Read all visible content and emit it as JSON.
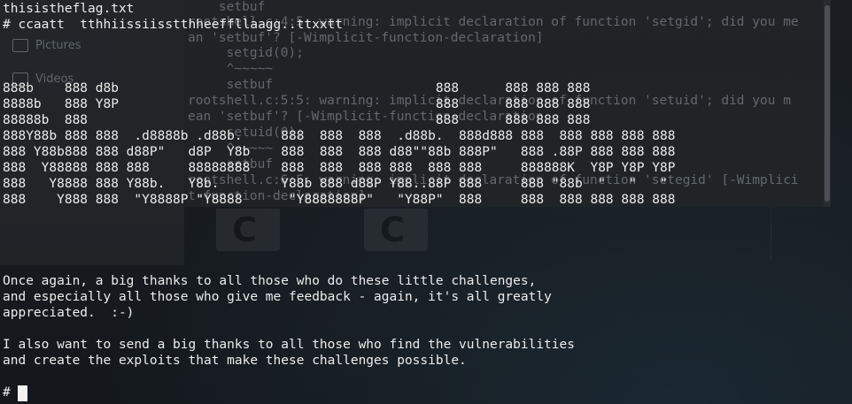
{
  "background": {
    "sidebar_items": [
      {
        "label": "Pictures",
        "icon": "folder-icon"
      },
      {
        "label": "Videos",
        "icon": "folder-icon"
      }
    ],
    "compiler_output": [
      {
        "plain": "    setbuf",
        "bold": ""
      },
      {
        "plain": "rootshell.c:4:5: warning: implicit declaration of function 'setgid'; did you me",
        "bold": ""
      },
      {
        "plain": "an 'setbuf'? [-Wimplicit-function-declaration]",
        "bold": ""
      },
      {
        "plain": "     setgid(0);",
        "bold": ""
      },
      {
        "plain": "     ^~~~~~",
        "bold": ""
      },
      {
        "plain": "     setbuf",
        "bold": ""
      },
      {
        "plain": "rootshell.c:5:5: warning: implicit declaration of function 'setuid'; did you m",
        "bold": ""
      },
      {
        "plain": "ean 'setbuf'? [-Wimplicit-function-declaration",
        "bold": ""
      },
      {
        "plain": "     setuid(0);",
        "bold": ""
      },
      {
        "plain": "     ^~~~~~",
        "bold": ""
      },
      {
        "plain": "     setbuf",
        "bold": ""
      },
      {
        "plain": "rootshell.c:6:5: warning: implicit declaration of function 'setegid' [-Wimplici",
        "bold": ""
      },
      {
        "plain": "t-function-declaration]",
        "bold": ""
      }
    ],
    "file_icons": [
      "C",
      "C"
    ]
  },
  "terminal": {
    "lines": [
      "thisistheflag.txt",
      "# ccaatt  tthhiissiisstthheeffllaagg..ttxxtt",
      "",
      "",
      "",
      "888b    888 d8b                                         888      888 888 888",
      "8888b   888 Y8P                                         888      888 888 888",
      "88888b  888                                             888      888 888 888",
      "888Y88b 888 888  .d8888b .d88b.     888  888  888  .d88b.  888d888 888  888 888 888 888",
      "888 Y88b888 888 d88P\"   d8P  Y8b    888  888  888 d88\"\"88b 888P\"   888 .88P 888 888 888",
      "888  Y88888 888 888     88888888    888  888  888 888  888 888     888888K  Y8P Y8P Y8P",
      "888   Y8888 888 Y88b.   Y8b.        Y88b 888 d88P Y88..88P 888     888 \"88b  \"   \"   \"",
      "888    Y888 888  \"Y8888P \"Y8888      \"Y8888888P\"   \"Y88P\"  888     888  888 888 888 888",
      "",
      "",
      "",
      "",
      "Once again, a big thanks to all those who do these little challenges,",
      "and especially all those who give me feedback - again, it's all greatly",
      "appreciated.  :-)",
      "",
      "I also want to send a big thanks to all those who find the vulnerabilities",
      "and create the exploits that make these challenges possible.",
      "",
      "",
      "# "
    ]
  }
}
